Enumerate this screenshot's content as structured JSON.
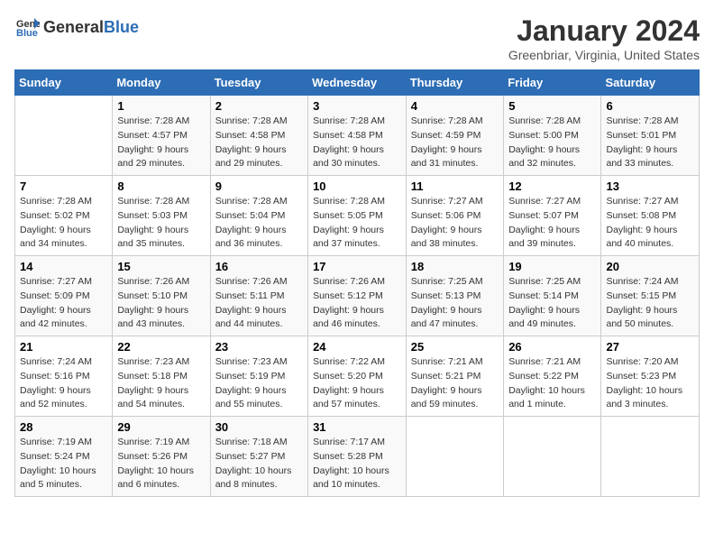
{
  "logo": {
    "general": "General",
    "blue": "Blue"
  },
  "title": "January 2024",
  "subtitle": "Greenbriar, Virginia, United States",
  "days_header": [
    "Sunday",
    "Monday",
    "Tuesday",
    "Wednesday",
    "Thursday",
    "Friday",
    "Saturday"
  ],
  "weeks": [
    [
      {
        "day": "",
        "data": ""
      },
      {
        "day": "1",
        "data": "Sunrise: 7:28 AM\nSunset: 4:57 PM\nDaylight: 9 hours\nand 29 minutes."
      },
      {
        "day": "2",
        "data": "Sunrise: 7:28 AM\nSunset: 4:58 PM\nDaylight: 9 hours\nand 29 minutes."
      },
      {
        "day": "3",
        "data": "Sunrise: 7:28 AM\nSunset: 4:58 PM\nDaylight: 9 hours\nand 30 minutes."
      },
      {
        "day": "4",
        "data": "Sunrise: 7:28 AM\nSunset: 4:59 PM\nDaylight: 9 hours\nand 31 minutes."
      },
      {
        "day": "5",
        "data": "Sunrise: 7:28 AM\nSunset: 5:00 PM\nDaylight: 9 hours\nand 32 minutes."
      },
      {
        "day": "6",
        "data": "Sunrise: 7:28 AM\nSunset: 5:01 PM\nDaylight: 9 hours\nand 33 minutes."
      }
    ],
    [
      {
        "day": "7",
        "data": "Sunrise: 7:28 AM\nSunset: 5:02 PM\nDaylight: 9 hours\nand 34 minutes."
      },
      {
        "day": "8",
        "data": "Sunrise: 7:28 AM\nSunset: 5:03 PM\nDaylight: 9 hours\nand 35 minutes."
      },
      {
        "day": "9",
        "data": "Sunrise: 7:28 AM\nSunset: 5:04 PM\nDaylight: 9 hours\nand 36 minutes."
      },
      {
        "day": "10",
        "data": "Sunrise: 7:28 AM\nSunset: 5:05 PM\nDaylight: 9 hours\nand 37 minutes."
      },
      {
        "day": "11",
        "data": "Sunrise: 7:27 AM\nSunset: 5:06 PM\nDaylight: 9 hours\nand 38 minutes."
      },
      {
        "day": "12",
        "data": "Sunrise: 7:27 AM\nSunset: 5:07 PM\nDaylight: 9 hours\nand 39 minutes."
      },
      {
        "day": "13",
        "data": "Sunrise: 7:27 AM\nSunset: 5:08 PM\nDaylight: 9 hours\nand 40 minutes."
      }
    ],
    [
      {
        "day": "14",
        "data": "Sunrise: 7:27 AM\nSunset: 5:09 PM\nDaylight: 9 hours\nand 42 minutes."
      },
      {
        "day": "15",
        "data": "Sunrise: 7:26 AM\nSunset: 5:10 PM\nDaylight: 9 hours\nand 43 minutes."
      },
      {
        "day": "16",
        "data": "Sunrise: 7:26 AM\nSunset: 5:11 PM\nDaylight: 9 hours\nand 44 minutes."
      },
      {
        "day": "17",
        "data": "Sunrise: 7:26 AM\nSunset: 5:12 PM\nDaylight: 9 hours\nand 46 minutes."
      },
      {
        "day": "18",
        "data": "Sunrise: 7:25 AM\nSunset: 5:13 PM\nDaylight: 9 hours\nand 47 minutes."
      },
      {
        "day": "19",
        "data": "Sunrise: 7:25 AM\nSunset: 5:14 PM\nDaylight: 9 hours\nand 49 minutes."
      },
      {
        "day": "20",
        "data": "Sunrise: 7:24 AM\nSunset: 5:15 PM\nDaylight: 9 hours\nand 50 minutes."
      }
    ],
    [
      {
        "day": "21",
        "data": "Sunrise: 7:24 AM\nSunset: 5:16 PM\nDaylight: 9 hours\nand 52 minutes."
      },
      {
        "day": "22",
        "data": "Sunrise: 7:23 AM\nSunset: 5:18 PM\nDaylight: 9 hours\nand 54 minutes."
      },
      {
        "day": "23",
        "data": "Sunrise: 7:23 AM\nSunset: 5:19 PM\nDaylight: 9 hours\nand 55 minutes."
      },
      {
        "day": "24",
        "data": "Sunrise: 7:22 AM\nSunset: 5:20 PM\nDaylight: 9 hours\nand 57 minutes."
      },
      {
        "day": "25",
        "data": "Sunrise: 7:21 AM\nSunset: 5:21 PM\nDaylight: 9 hours\nand 59 minutes."
      },
      {
        "day": "26",
        "data": "Sunrise: 7:21 AM\nSunset: 5:22 PM\nDaylight: 10 hours\nand 1 minute."
      },
      {
        "day": "27",
        "data": "Sunrise: 7:20 AM\nSunset: 5:23 PM\nDaylight: 10 hours\nand 3 minutes."
      }
    ],
    [
      {
        "day": "28",
        "data": "Sunrise: 7:19 AM\nSunset: 5:24 PM\nDaylight: 10 hours\nand 5 minutes."
      },
      {
        "day": "29",
        "data": "Sunrise: 7:19 AM\nSunset: 5:26 PM\nDaylight: 10 hours\nand 6 minutes."
      },
      {
        "day": "30",
        "data": "Sunrise: 7:18 AM\nSunset: 5:27 PM\nDaylight: 10 hours\nand 8 minutes."
      },
      {
        "day": "31",
        "data": "Sunrise: 7:17 AM\nSunset: 5:28 PM\nDaylight: 10 hours\nand 10 minutes."
      },
      {
        "day": "",
        "data": ""
      },
      {
        "day": "",
        "data": ""
      },
      {
        "day": "",
        "data": ""
      }
    ]
  ]
}
